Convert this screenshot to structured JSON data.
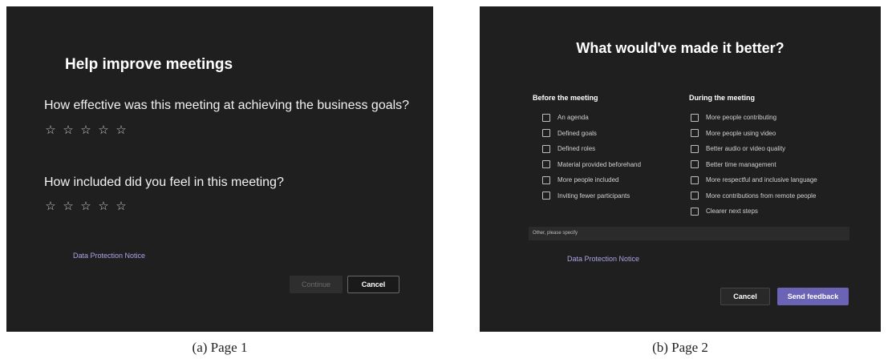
{
  "page1": {
    "title": "Help improve meetings",
    "question1": "How effective was this meeting at achieving the business goals?",
    "question2": "How included did you feel in this meeting?",
    "star_glyph": "☆",
    "data_protection": "Data Protection Notice",
    "continue_label": "Continue",
    "cancel_label": "Cancel",
    "caption": "(a) Page 1"
  },
  "page2": {
    "title": "What would've made it better?",
    "before_heading": "Before the meeting",
    "during_heading": "During the meeting",
    "before_options": [
      "An agenda",
      "Defined goals",
      "Defined roles",
      "Material provided beforehand",
      "More people included",
      "Inviting fewer participants"
    ],
    "during_options": [
      "More people contributing",
      "More people using video",
      "Better audio or video quality",
      "Better time management",
      "More respectful and inclusive language",
      "More contributions from remote people",
      "Clearer next steps"
    ],
    "other_placeholder": "Other, please specify",
    "data_protection": "Data Protection Notice",
    "cancel_label": "Cancel",
    "send_label": "Send feedback",
    "caption": "(b) Page 2"
  },
  "colors": {
    "panel": "#201f1f",
    "accent": "#6b63b5",
    "link": "#a9a6e6"
  }
}
